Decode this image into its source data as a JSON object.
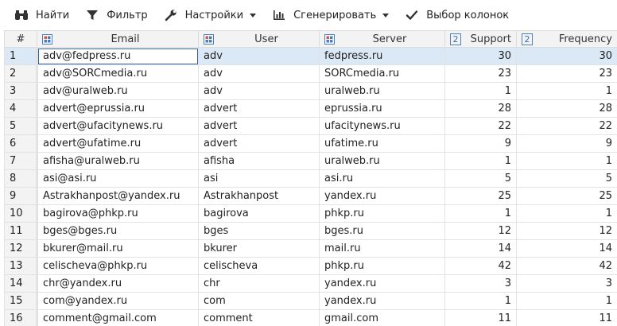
{
  "toolbar": {
    "find": "Найти",
    "filter": "Фильтр",
    "settings": "Настройки",
    "generate": "Сгенерировать",
    "columns": "Выбор колонок"
  },
  "columns": {
    "num": "#",
    "email": "Email",
    "user": "User",
    "server": "Server",
    "support": "Support",
    "frequency": "Frequency"
  },
  "rows": [
    {
      "n": "1",
      "email": "adv@fedpress.ru",
      "user": "adv",
      "server": "fedpress.ru",
      "support": "30",
      "frequency": "30"
    },
    {
      "n": "2",
      "email": "adv@SORCmedia.ru",
      "user": "adv",
      "server": "SORCmedia.ru",
      "support": "23",
      "frequency": "23"
    },
    {
      "n": "3",
      "email": "adv@uralweb.ru",
      "user": "adv",
      "server": "uralweb.ru",
      "support": "1",
      "frequency": "1"
    },
    {
      "n": "4",
      "email": "advert@eprussia.ru",
      "user": "advert",
      "server": "eprussia.ru",
      "support": "28",
      "frequency": "28"
    },
    {
      "n": "5",
      "email": "advert@ufacitynews.ru",
      "user": "advert",
      "server": "ufacitynews.ru",
      "support": "22",
      "frequency": "22"
    },
    {
      "n": "6",
      "email": "advert@ufatime.ru",
      "user": "advert",
      "server": "ufatime.ru",
      "support": "9",
      "frequency": "9"
    },
    {
      "n": "7",
      "email": "afisha@uralweb.ru",
      "user": "afisha",
      "server": "uralweb.ru",
      "support": "1",
      "frequency": "1"
    },
    {
      "n": "8",
      "email": "asi@asi.ru",
      "user": "asi",
      "server": "asi.ru",
      "support": "5",
      "frequency": "5"
    },
    {
      "n": "9",
      "email": "Astrakhanpost@yandex.ru",
      "user": "Astrakhanpost",
      "server": "yandex.ru",
      "support": "25",
      "frequency": "25"
    },
    {
      "n": "10",
      "email": "bagirova@phkp.ru",
      "user": "bagirova",
      "server": "phkp.ru",
      "support": "1",
      "frequency": "1"
    },
    {
      "n": "11",
      "email": "bges@bges.ru",
      "user": "bges",
      "server": "bges.ru",
      "support": "12",
      "frequency": "12"
    },
    {
      "n": "12",
      "email": "bkurer@mail.ru",
      "user": "bkurer",
      "server": "mail.ru",
      "support": "14",
      "frequency": "14"
    },
    {
      "n": "13",
      "email": "celischeva@phkp.ru",
      "user": "celischeva",
      "server": "phkp.ru",
      "support": "42",
      "frequency": "42"
    },
    {
      "n": "14",
      "email": "chr@yandex.ru",
      "user": "chr",
      "server": "yandex.ru",
      "support": "3",
      "frequency": "3"
    },
    {
      "n": "15",
      "email": "com@yandex.ru",
      "user": "com",
      "server": "yandex.ru",
      "support": "1",
      "frequency": "1"
    },
    {
      "n": "16",
      "email": "comment@gmail.com",
      "user": "comment",
      "server": "gmail.com",
      "support": "11",
      "frequency": "11"
    }
  ],
  "colors": {
    "selected_row": "#dbe8f6",
    "selected_cell_border": "#2f5fa8",
    "header_bg": "#f3f3f3"
  },
  "icons": {
    "find": "binoculars-icon",
    "filter": "funnel-icon",
    "settings": "wrench-icon",
    "generate": "bar-chart-icon",
    "columns": "checkmark-icon",
    "text_column": "text-type-icon",
    "numeric_column": "numeric-type-icon"
  }
}
